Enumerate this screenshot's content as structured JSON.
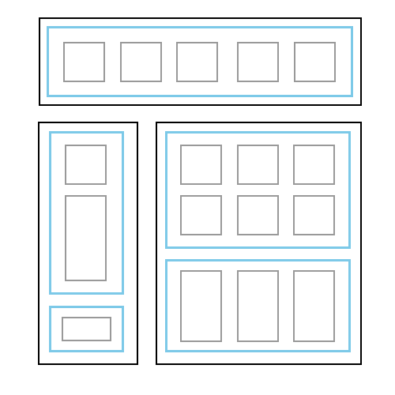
{
  "colors": {
    "background": "#ffffff",
    "panel_border": "#000000",
    "group_border": "#7cc9e8",
    "cell_border": "#999999"
  },
  "layout_diagram": {
    "panels": [
      {
        "name": "top-panel",
        "groups": [
          {
            "name": "top-row-group",
            "cells": 5
          }
        ]
      },
      {
        "name": "left-panel",
        "groups": [
          {
            "name": "left-upper-group",
            "cells": 2
          },
          {
            "name": "left-lower-group",
            "cells": 1
          }
        ]
      },
      {
        "name": "right-panel",
        "groups": [
          {
            "name": "right-grid-group",
            "cells": 6
          },
          {
            "name": "right-columns-group",
            "cells": 3
          }
        ]
      }
    ]
  }
}
